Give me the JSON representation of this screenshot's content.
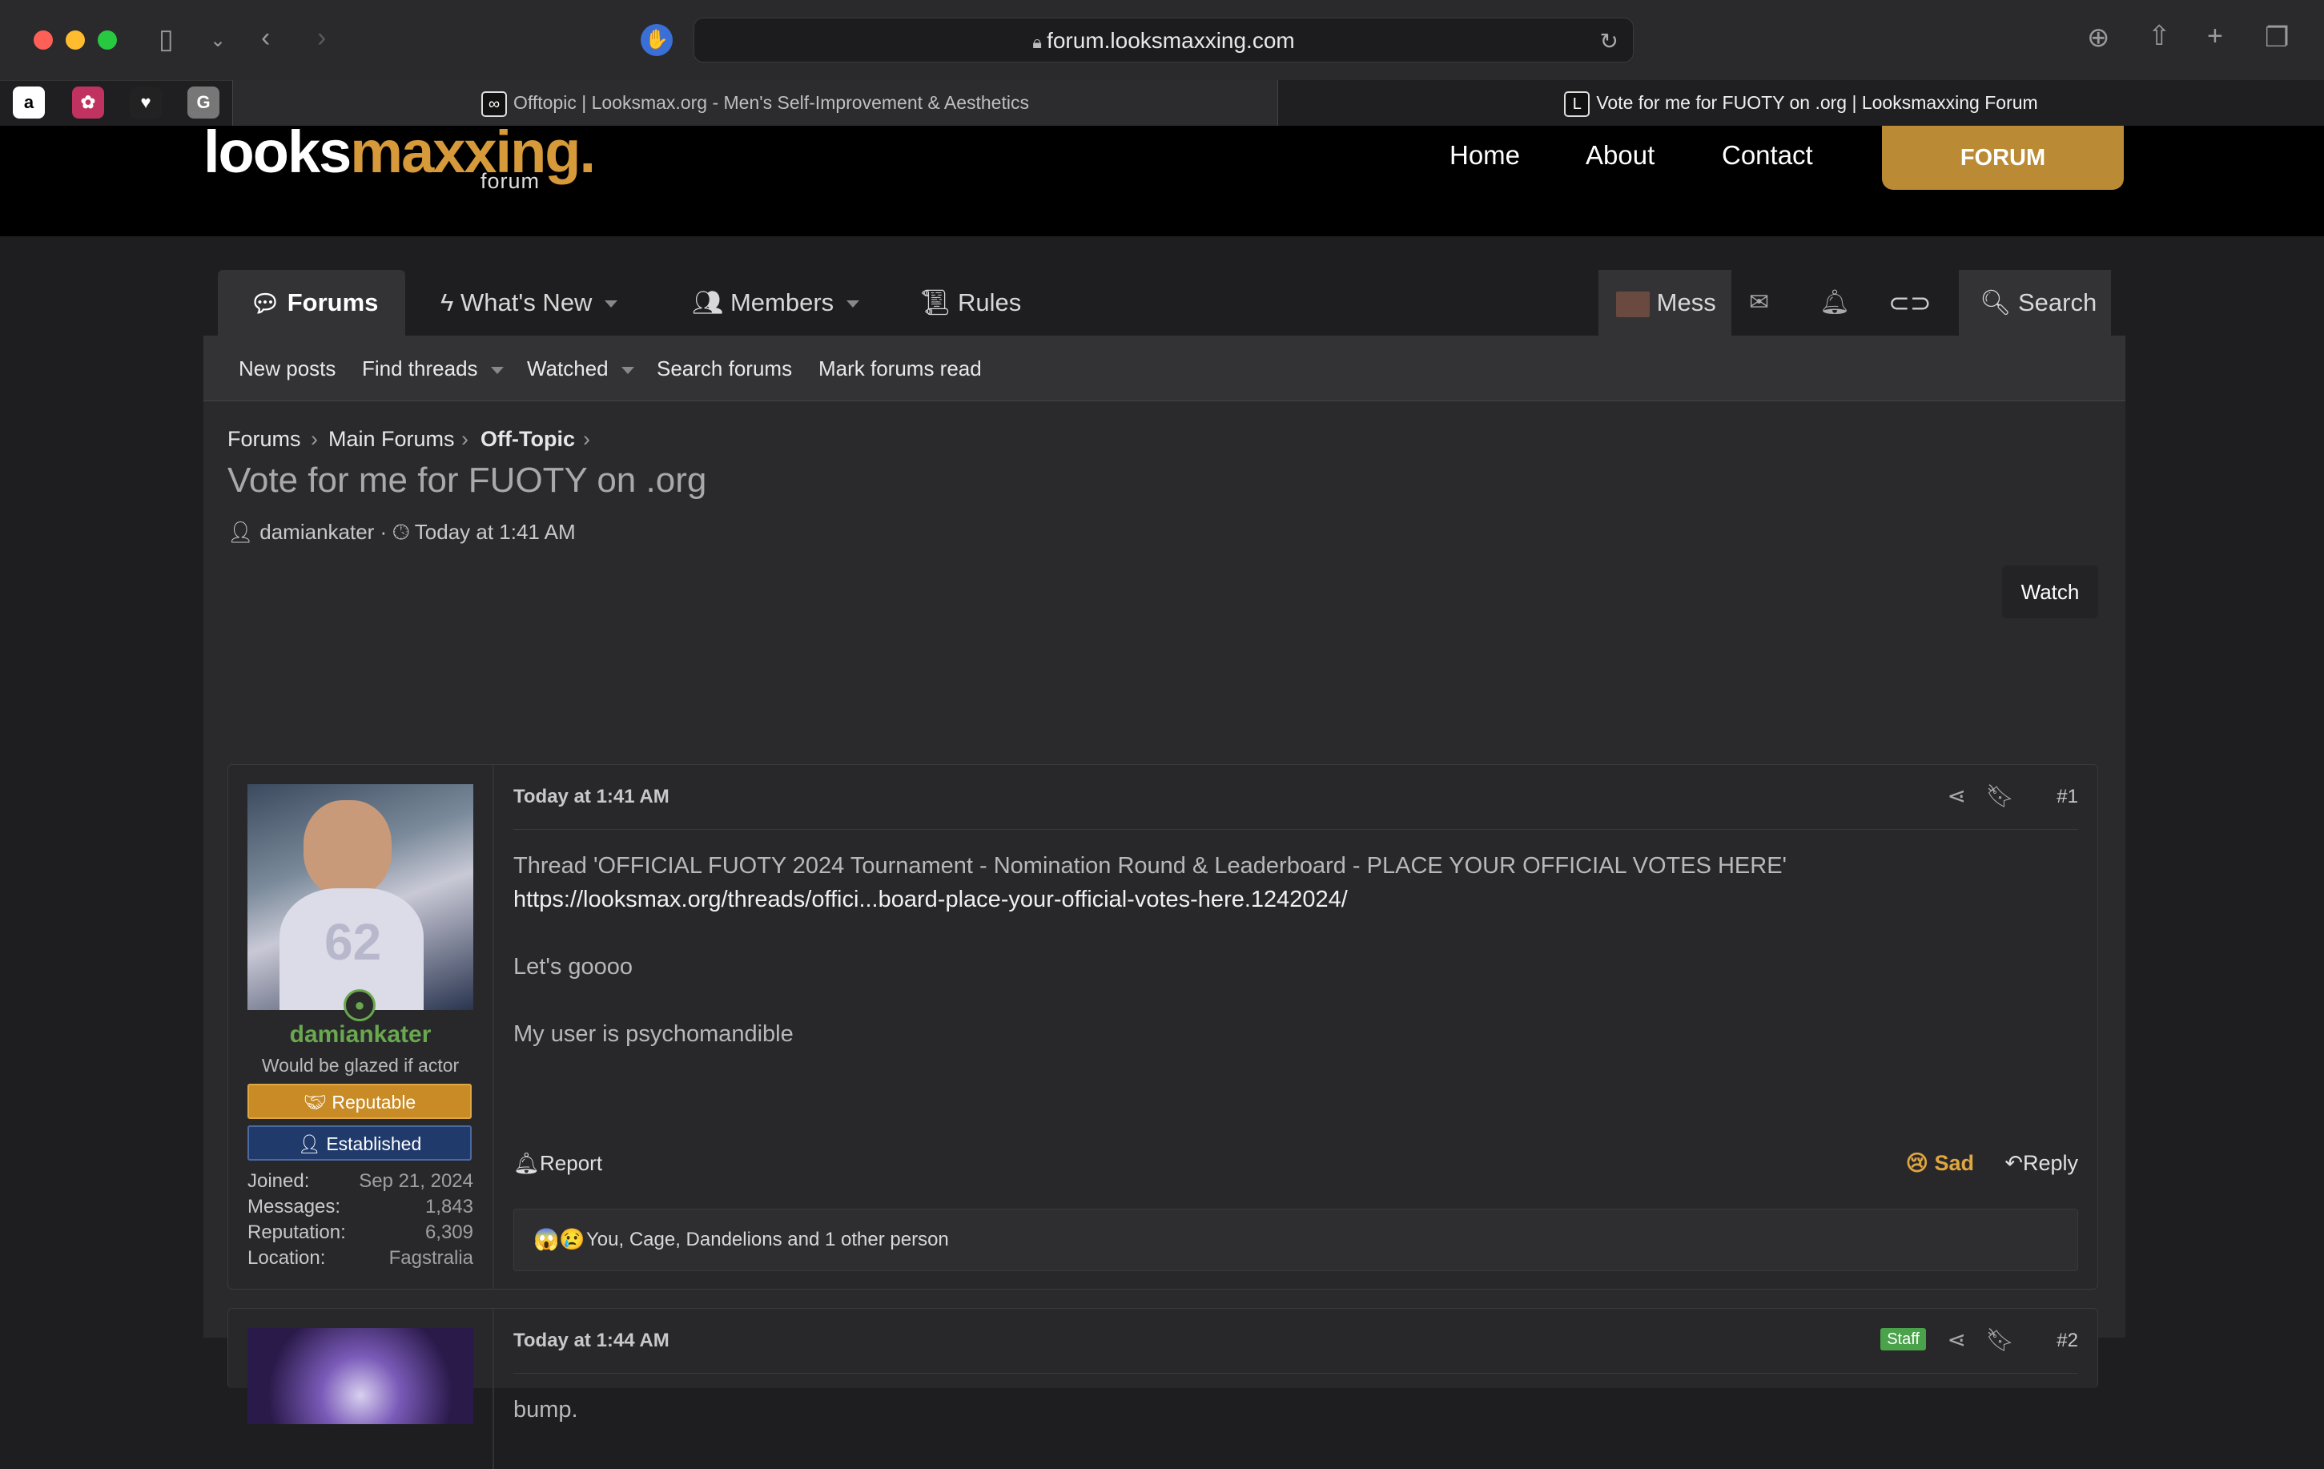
{
  "browser": {
    "url": "forum.looksmaxxing.com",
    "pinned_tabs": [
      "a",
      "✿",
      "♥",
      "G"
    ],
    "tabs": [
      {
        "icon": "∞",
        "label": "Offtopic | Looksmax.org - Men's Self-Improvement & Aesthetics"
      },
      {
        "icon": "L",
        "label": "Vote for me for FUOTY on .org | Looksmaxxing Forum"
      }
    ]
  },
  "site": {
    "logo_main": "looks",
    "logo_accent": "maxxing.",
    "logo_sub": "forum",
    "links": [
      "Home",
      "About",
      "Contact"
    ],
    "forum_button": "FORUM"
  },
  "nav": {
    "items": [
      "Forums",
      "What's New",
      "Members",
      "Rules"
    ],
    "mess": "Mess",
    "search": "Search"
  },
  "subnav": [
    "New posts",
    "Find threads",
    "Watched",
    "Search forums",
    "Mark forums read"
  ],
  "breadcrumb": [
    "Forums",
    "Main Forums",
    "Off-Topic"
  ],
  "thread": {
    "title": "Vote for me for FUOTY on .org",
    "author": "damiankater",
    "date": "Today at 1:41 AM",
    "watch": "Watch"
  },
  "post1": {
    "username": "damiankater",
    "usertitle": "Would be glazed if actor",
    "badge1": "Reputable",
    "badge2": "Established",
    "stats": [
      {
        "label": "Joined:",
        "value": "Sep 21, 2024"
      },
      {
        "label": "Messages:",
        "value": "1,843"
      },
      {
        "label": "Reputation:",
        "value": "6,309"
      },
      {
        "label": "Location:",
        "value": "Fagstralia"
      }
    ],
    "time": "Today at 1:41 AM",
    "number": "#1",
    "line1": "Thread 'OFFICIAL FUOTY 2024 Tournament - Nomination Round & Leaderboard - PLACE YOUR OFFICIAL VOTES HERE'",
    "link": "https://looksmax.org/threads/offici...board-place-your-official-votes-here.1242024/",
    "line2": "Let's goooo",
    "line3": "My user is psychomandible",
    "report": "Report",
    "reaction": "Sad",
    "reply": "Reply",
    "reactions_summary": "You, Cage, Dandelions and 1 other person"
  },
  "post2": {
    "time": "Today at 1:44 AM",
    "staff": "Staff",
    "number": "#2",
    "text": "bump."
  },
  "colors": {
    "accent": "#bb8a35",
    "username": "#6aa84f",
    "reputable": "#c98b26",
    "established": "#1f3a6b",
    "staff": "#4aa24a"
  }
}
